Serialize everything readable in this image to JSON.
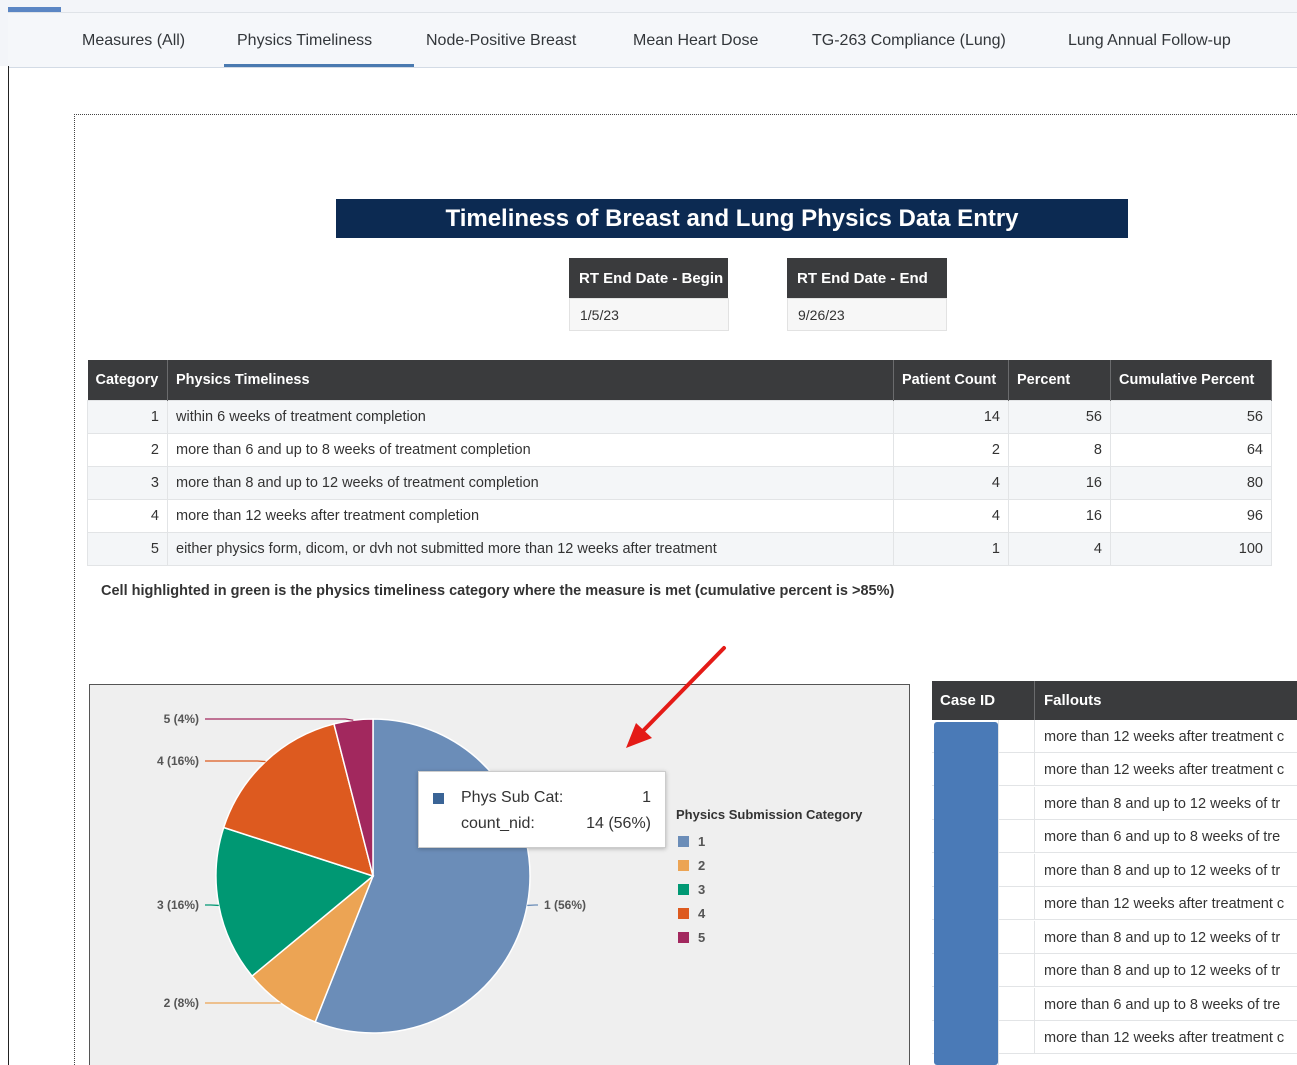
{
  "tabs": [
    {
      "label": "Measures (All)",
      "active": false
    },
    {
      "label": "Physics Timeliness",
      "active": true
    },
    {
      "label": "Node-Positive Breast",
      "active": false
    },
    {
      "label": "Mean Heart Dose",
      "active": false
    },
    {
      "label": "TG-263 Compliance (Lung)",
      "active": false
    },
    {
      "label": "Lung Annual Follow-up",
      "active": false
    }
  ],
  "report": {
    "title": "Timeliness of Breast and Lung Physics Data Entry",
    "date_begin": {
      "label": "RT End Date - Begin",
      "value": "1/5/23"
    },
    "date_end": {
      "label": "RT End Date - End",
      "value": "9/26/23"
    }
  },
  "summary_table": {
    "columns": [
      "Category",
      "Physics Timeliness",
      "Patient Count",
      "Percent",
      "Cumulative Percent"
    ],
    "rows": [
      {
        "category": "1",
        "timeliness": "within 6 weeks of treatment completion",
        "count": "14",
        "percent": "56",
        "cumulative": "56"
      },
      {
        "category": "2",
        "timeliness": "more than 6 and up to 8 weeks of treatment completion",
        "count": "2",
        "percent": "8",
        "cumulative": "64"
      },
      {
        "category": "3",
        "timeliness": "more than 8 and up to 12 weeks of treatment completion",
        "count": "4",
        "percent": "16",
        "cumulative": "80"
      },
      {
        "category": "4",
        "timeliness": "more than 12 weeks after treatment completion",
        "count": "4",
        "percent": "16",
        "cumulative": "96"
      },
      {
        "category": "5",
        "timeliness": "either physics form, dicom, or dvh not submitted more than 12 weeks after treatment",
        "count": "1",
        "percent": "4",
        "cumulative": "100"
      }
    ],
    "note": "Cell highlighted in green is the physics timeliness category where the measure is met (cumulative percent is >85%)"
  },
  "chart_data": {
    "type": "pie",
    "title": "",
    "legend_title": "Physics Submission Category",
    "legend_position": "right",
    "categories": [
      "1",
      "2",
      "3",
      "4",
      "5"
    ],
    "values": [
      14,
      2,
      4,
      4,
      1
    ],
    "slice_labels": [
      "1 (56%)",
      "2 (8%)",
      "3 (16%)",
      "4 (16%)",
      "5 (4%)"
    ],
    "colors": [
      "#6b8db8",
      "#eca454",
      "#009873",
      "#dd5a1f",
      "#a2285e"
    ]
  },
  "tooltip": {
    "line1_label": "Phys Sub Cat:",
    "line1_value": "1",
    "line2_label": "count_nid:",
    "line2_value": "14 (56%)"
  },
  "fallouts": {
    "columns": [
      "Case ID",
      "Fallouts"
    ],
    "rows": [
      "more than 12 weeks after treatment c",
      "more than 12 weeks after treatment c",
      "more than 8 and up to 12 weeks of tr",
      "more than 6 and up to 8 weeks of tre",
      "more than 8 and up to 12 weeks of tr",
      "more than 12 weeks after treatment c",
      "more than 8 and up to 12 weeks of tr",
      "more than 8 and up to 12 weeks of tr",
      "more than 6 and up to 8 weeks of tre",
      "more than 12 weeks after treatment c"
    ]
  },
  "colors": {
    "header_dark": "#3a3b3d",
    "banner_navy": "#0c2a52",
    "tab_accent": "#4a7ab0",
    "annotation_arrow": "#e41b17"
  }
}
